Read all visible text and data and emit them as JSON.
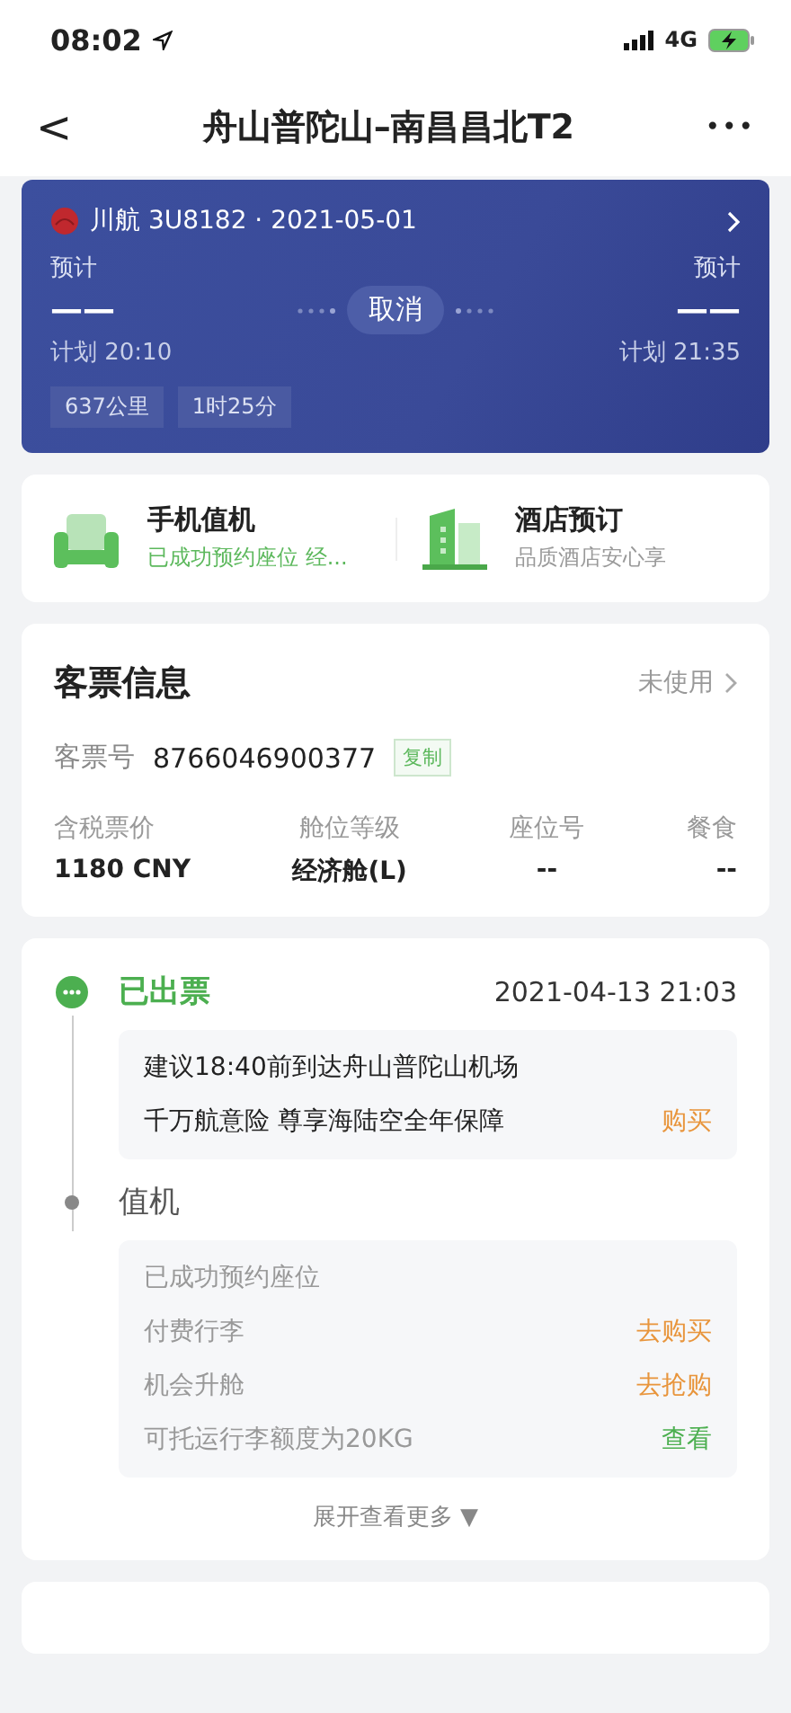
{
  "status_bar": {
    "time": "08:02",
    "network": "4G"
  },
  "nav": {
    "back": "<",
    "title": "舟山普陀山–南昌昌北T2",
    "more": "•••"
  },
  "flight": {
    "airline": "川航 3U8182 · 2021-05-01",
    "dep": {
      "label": "预计",
      "time": "——",
      "plan": "计划 20:10"
    },
    "status": "取消",
    "arr": {
      "label": "预计",
      "time": "——",
      "plan": "计划 21:35"
    },
    "tags": [
      "637公里",
      "1时25分"
    ]
  },
  "services": [
    {
      "kind": "seat",
      "title": "手机值机",
      "subtitle": "已成功预约座位 经...",
      "highlight": true
    },
    {
      "kind": "building",
      "title": "酒店预订",
      "subtitle": "品质酒店安心享",
      "highlight": false
    }
  ],
  "ticket": {
    "title": "客票信息",
    "status": "未使用",
    "number_label": "客票号",
    "number": "8766046900377",
    "copy": "复制",
    "columns": [
      {
        "label": "含税票价",
        "value": "1180 CNY"
      },
      {
        "label": "舱位等级",
        "value": "经济舱(L)"
      },
      {
        "label": "座位号",
        "value": "--"
      },
      {
        "label": "餐食",
        "value": "--"
      }
    ]
  },
  "timeline": [
    {
      "title": "已出票",
      "time": "2021-04-13 21:03",
      "done": true,
      "rows": [
        {
          "text": "建议18:40前到达舟山普陀山机场",
          "strong": true
        },
        {
          "text": "千万航意险 尊享海陆空全年保障",
          "strong": true,
          "action": "购买",
          "color": "#e8953c"
        }
      ]
    },
    {
      "title": "值机",
      "done": false,
      "rows": [
        {
          "text": "已成功预约座位",
          "strong": false
        },
        {
          "text": "付费行李",
          "strong": false,
          "action": "去购买",
          "color": "#e8953c"
        },
        {
          "text": "机会升舱",
          "strong": false,
          "action": "去抢购",
          "color": "#e8953c"
        },
        {
          "text": "可托运行李额度为20KG",
          "strong": false,
          "action": "查看",
          "color": "#4caf50"
        }
      ]
    }
  ],
  "expand": "展开查看更多 ▼"
}
